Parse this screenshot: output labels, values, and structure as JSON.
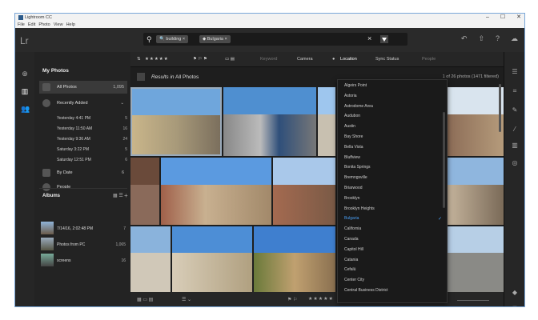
{
  "window": {
    "title": "Lightroom CC",
    "controls": [
      "–",
      "☐",
      "✕"
    ]
  },
  "menu": [
    "File",
    "Edit",
    "Photo",
    "View",
    "Help"
  ],
  "app_logo": "Lr",
  "search": {
    "chips": [
      "building",
      "Bulgaria"
    ]
  },
  "top_icons": [
    "undo-icon",
    "share-icon",
    "help-icon",
    "cloud-icon"
  ],
  "sidebar": {
    "title": "My Photos",
    "all_photos": {
      "label": "All Photos",
      "count": "1,095"
    },
    "recently_added": {
      "label": "Recently Added",
      "items": [
        {
          "label": "Yesterday 4:41 PM",
          "count": "5"
        },
        {
          "label": "Yesterday 11:50 AM",
          "count": "16"
        },
        {
          "label": "Yesterday 9:36 AM",
          "count": "24"
        },
        {
          "label": "Saturday 3:22 PM",
          "count": "5"
        },
        {
          "label": "Saturday 12:51 PM",
          "count": "6"
        }
      ]
    },
    "by_date": {
      "label": "By Date",
      "count": "6"
    },
    "people": {
      "label": "People"
    },
    "albums_title": "Albums",
    "albums": [
      {
        "label": "7/14/16, 2:02:48 PM",
        "count": "7"
      },
      {
        "label": "Photos from PC",
        "count": "1,065"
      },
      {
        "label": "screens",
        "count": "16"
      }
    ]
  },
  "filterbar": {
    "stars": "★★★★★",
    "keyword": "Keyword",
    "camera": "Camera",
    "location": "Location",
    "sync": "Sync Status",
    "people": "People"
  },
  "results": {
    "label_prefix": "Results in",
    "label_scope": "All Photos",
    "count": "1 of 26 photos (1471 filtered)"
  },
  "dropdown": {
    "items": [
      "Algeirs Point",
      "Astoria",
      "Astrodome Area",
      "Audubon",
      "Austin",
      "Bay Shore",
      "Bella Vista",
      "Bluffview",
      "Bonita Springs",
      "Bremngsville",
      "Briarwood",
      "Brooklyn",
      "Brooklyn Heights",
      "Bulgaria",
      "California",
      "Canada",
      "Capitol Hill",
      "Catania",
      "Cefalù",
      "Center City",
      "Central Business District"
    ],
    "selected": "Bulgaria"
  },
  "bottombar": {
    "stars": "★★★★★"
  },
  "colors": {
    "accent": "#4a9ff5",
    "panel": "#232323",
    "background": "#1e1e1e"
  }
}
